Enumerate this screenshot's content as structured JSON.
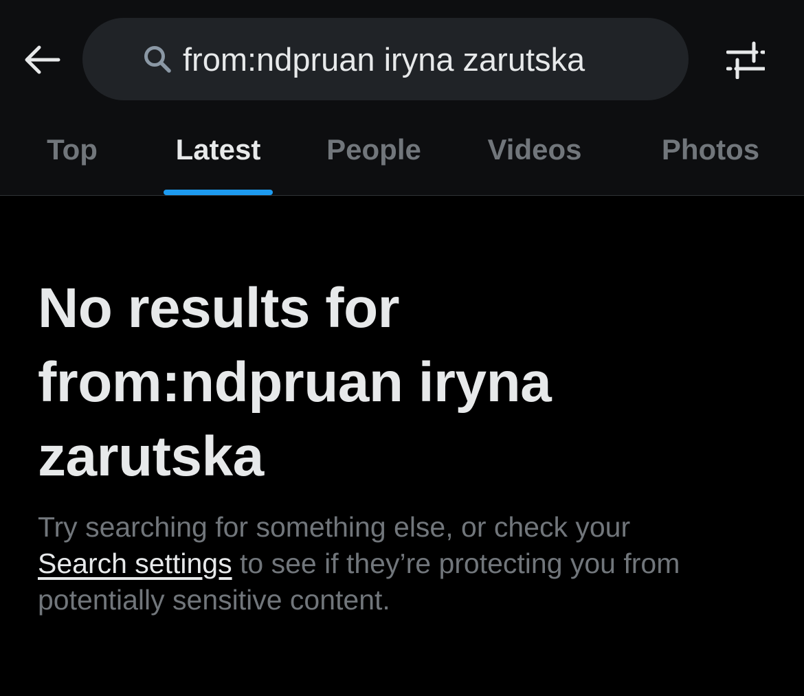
{
  "header": {
    "back_icon": "arrow-left-icon",
    "search": {
      "icon": "search-icon",
      "value": "from:ndpruan iryna zarutska"
    },
    "filter_icon": "sliders-icon"
  },
  "tabs": [
    {
      "label": "Top",
      "active": false
    },
    {
      "label": "Latest",
      "active": true
    },
    {
      "label": "People",
      "active": false
    },
    {
      "label": "Videos",
      "active": false
    },
    {
      "label": "Photos",
      "active": false
    }
  ],
  "empty_state": {
    "title_prefix": "No results for",
    "query": "from:ndpruan iryna zarutska",
    "body_before_link": "Try searching for something else, or check your",
    "link_label": "Search settings",
    "body_after_link": "to see if they’re protecting you from potentially sensitive content."
  },
  "colors": {
    "background": "#000000",
    "header_background": "#0d0e10",
    "search_pill": "#202327",
    "primary_text": "#e7e9ea",
    "secondary_text": "#71767b",
    "accent": "#1d9bf0"
  }
}
